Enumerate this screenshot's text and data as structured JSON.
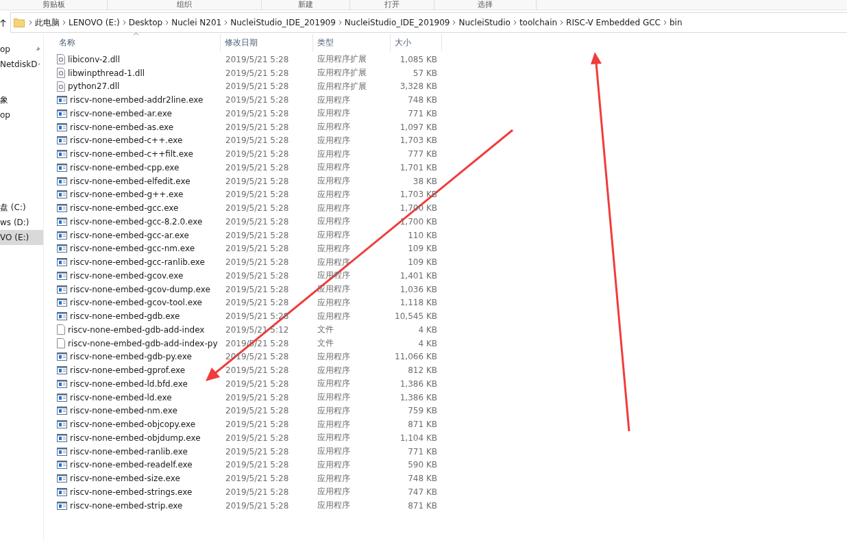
{
  "ribbon": {
    "groups": [
      "剪贴板",
      "组织",
      "新建",
      "打开",
      "选择"
    ]
  },
  "address_bar": {
    "crumbs": [
      "此电脑",
      "LENOVO (E:)",
      "Desktop",
      "Nuclei N201",
      "NucleiStudio_IDE_201909",
      "NucleiStudio_IDE_201909",
      "NucleiStudio",
      "toolchain",
      "RISC-V Embedded GCC",
      "bin"
    ]
  },
  "sidebar": {
    "groups": [
      [
        {
          "label": "op",
          "pinned": true,
          "selected": false
        },
        {
          "label": "NetdiskD",
          "pinned": true,
          "selected": false
        }
      ],
      [
        {
          "label": "象",
          "pinned": false,
          "selected": false
        },
        {
          "label": "op",
          "pinned": false,
          "selected": false
        }
      ],
      [
        {
          "label": "盘 (C:)",
          "pinned": false,
          "selected": false
        },
        {
          "label": "ws (D:)",
          "pinned": false,
          "selected": false
        },
        {
          "label": "VO (E:)",
          "pinned": false,
          "selected": true
        }
      ]
    ]
  },
  "table": {
    "columns": [
      {
        "label": "名称",
        "sorted": true
      },
      {
        "label": "修改日期",
        "sorted": false
      },
      {
        "label": "类型",
        "sorted": false
      },
      {
        "label": "大小",
        "sorted": false
      }
    ],
    "rows": [
      {
        "kind": "dll",
        "name": "libiconv-2.dll",
        "date": "2019/5/21 5:28",
        "type": "应用程序扩展",
        "size": "1,085 KB"
      },
      {
        "kind": "dll",
        "name": "libwinpthread-1.dll",
        "date": "2019/5/21 5:28",
        "type": "应用程序扩展",
        "size": "57 KB"
      },
      {
        "kind": "dll",
        "name": "python27.dll",
        "date": "2019/5/21 5:28",
        "type": "应用程序扩展",
        "size": "3,328 KB"
      },
      {
        "kind": "exe",
        "name": "riscv-none-embed-addr2line.exe",
        "date": "2019/5/21 5:28",
        "type": "应用程序",
        "size": "748 KB"
      },
      {
        "kind": "exe",
        "name": "riscv-none-embed-ar.exe",
        "date": "2019/5/21 5:28",
        "type": "应用程序",
        "size": "771 KB"
      },
      {
        "kind": "exe",
        "name": "riscv-none-embed-as.exe",
        "date": "2019/5/21 5:28",
        "type": "应用程序",
        "size": "1,097 KB"
      },
      {
        "kind": "exe",
        "name": "riscv-none-embed-c++.exe",
        "date": "2019/5/21 5:28",
        "type": "应用程序",
        "size": "1,703 KB"
      },
      {
        "kind": "exe",
        "name": "riscv-none-embed-c++filt.exe",
        "date": "2019/5/21 5:28",
        "type": "应用程序",
        "size": "777 KB"
      },
      {
        "kind": "exe",
        "name": "riscv-none-embed-cpp.exe",
        "date": "2019/5/21 5:28",
        "type": "应用程序",
        "size": "1,701 KB"
      },
      {
        "kind": "exe",
        "name": "riscv-none-embed-elfedit.exe",
        "date": "2019/5/21 5:28",
        "type": "应用程序",
        "size": "38 KB"
      },
      {
        "kind": "exe",
        "name": "riscv-none-embed-g++.exe",
        "date": "2019/5/21 5:28",
        "type": "应用程序",
        "size": "1,703 KB"
      },
      {
        "kind": "exe",
        "name": "riscv-none-embed-gcc.exe",
        "date": "2019/5/21 5:28",
        "type": "应用程序",
        "size": "1,700 KB"
      },
      {
        "kind": "exe",
        "name": "riscv-none-embed-gcc-8.2.0.exe",
        "date": "2019/5/21 5:28",
        "type": "应用程序",
        "size": "1,700 KB"
      },
      {
        "kind": "exe",
        "name": "riscv-none-embed-gcc-ar.exe",
        "date": "2019/5/21 5:28",
        "type": "应用程序",
        "size": "110 KB"
      },
      {
        "kind": "exe",
        "name": "riscv-none-embed-gcc-nm.exe",
        "date": "2019/5/21 5:28",
        "type": "应用程序",
        "size": "109 KB"
      },
      {
        "kind": "exe",
        "name": "riscv-none-embed-gcc-ranlib.exe",
        "date": "2019/5/21 5:28",
        "type": "应用程序",
        "size": "109 KB"
      },
      {
        "kind": "exe",
        "name": "riscv-none-embed-gcov.exe",
        "date": "2019/5/21 5:28",
        "type": "应用程序",
        "size": "1,401 KB"
      },
      {
        "kind": "exe",
        "name": "riscv-none-embed-gcov-dump.exe",
        "date": "2019/5/21 5:28",
        "type": "应用程序",
        "size": "1,036 KB"
      },
      {
        "kind": "exe",
        "name": "riscv-none-embed-gcov-tool.exe",
        "date": "2019/5/21 5:28",
        "type": "应用程序",
        "size": "1,118 KB"
      },
      {
        "kind": "exe",
        "name": "riscv-none-embed-gdb.exe",
        "date": "2019/5/21 5:28",
        "type": "应用程序",
        "size": "10,545 KB"
      },
      {
        "kind": "file",
        "name": "riscv-none-embed-gdb-add-index",
        "date": "2019/5/21 5:12",
        "type": "文件",
        "size": "4 KB"
      },
      {
        "kind": "file",
        "name": "riscv-none-embed-gdb-add-index-py",
        "date": "2019/5/21 5:28",
        "type": "文件",
        "size": "4 KB"
      },
      {
        "kind": "exe",
        "name": "riscv-none-embed-gdb-py.exe",
        "date": "2019/5/21 5:28",
        "type": "应用程序",
        "size": "11,066 KB"
      },
      {
        "kind": "exe",
        "name": "riscv-none-embed-gprof.exe",
        "date": "2019/5/21 5:28",
        "type": "应用程序",
        "size": "812 KB"
      },
      {
        "kind": "exe",
        "name": "riscv-none-embed-ld.bfd.exe",
        "date": "2019/5/21 5:28",
        "type": "应用程序",
        "size": "1,386 KB"
      },
      {
        "kind": "exe",
        "name": "riscv-none-embed-ld.exe",
        "date": "2019/5/21 5:28",
        "type": "应用程序",
        "size": "1,386 KB"
      },
      {
        "kind": "exe",
        "name": "riscv-none-embed-nm.exe",
        "date": "2019/5/21 5:28",
        "type": "应用程序",
        "size": "759 KB"
      },
      {
        "kind": "exe",
        "name": "riscv-none-embed-objcopy.exe",
        "date": "2019/5/21 5:28",
        "type": "应用程序",
        "size": "871 KB"
      },
      {
        "kind": "exe",
        "name": "riscv-none-embed-objdump.exe",
        "date": "2019/5/21 5:28",
        "type": "应用程序",
        "size": "1,104 KB"
      },
      {
        "kind": "exe",
        "name": "riscv-none-embed-ranlib.exe",
        "date": "2019/5/21 5:28",
        "type": "应用程序",
        "size": "771 KB"
      },
      {
        "kind": "exe",
        "name": "riscv-none-embed-readelf.exe",
        "date": "2019/5/21 5:28",
        "type": "应用程序",
        "size": "590 KB"
      },
      {
        "kind": "exe",
        "name": "riscv-none-embed-size.exe",
        "date": "2019/5/21 5:28",
        "type": "应用程序",
        "size": "748 KB"
      },
      {
        "kind": "exe",
        "name": "riscv-none-embed-strings.exe",
        "date": "2019/5/21 5:28",
        "type": "应用程序",
        "size": "747 KB"
      },
      {
        "kind": "exe",
        "name": "riscv-none-embed-strip.exe",
        "date": "2019/5/21 5:28",
        "type": "应用程序",
        "size": "871 KB"
      }
    ]
  }
}
